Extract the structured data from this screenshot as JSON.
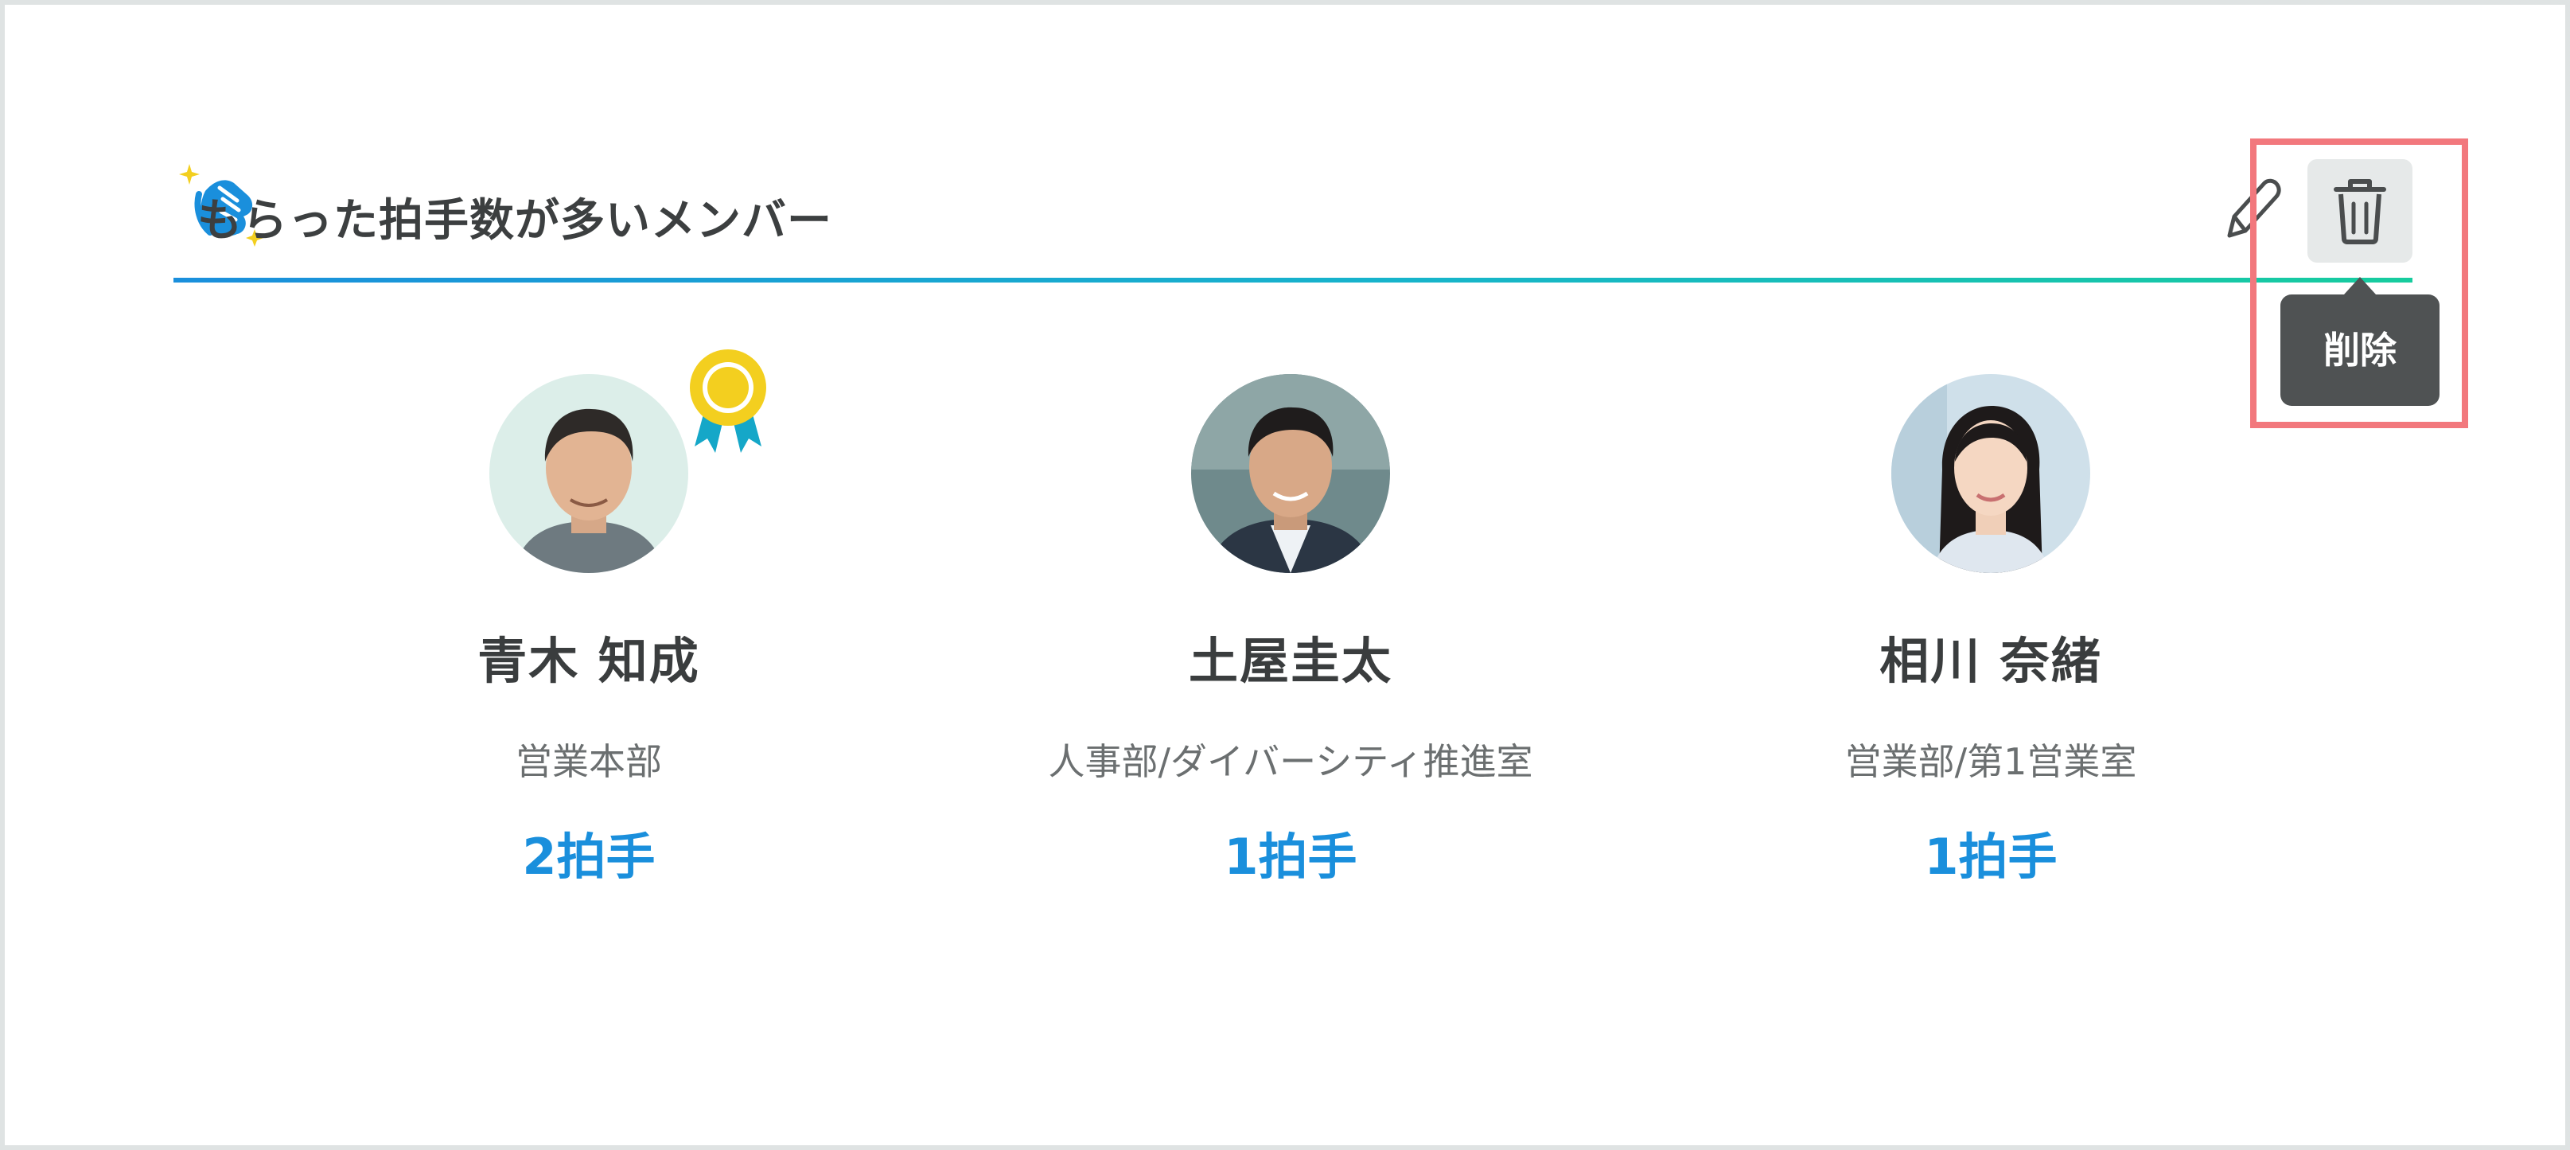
{
  "widget": {
    "title": "もらった拍手数が多いメンバー",
    "edit_icon": "pencil-icon",
    "delete_icon": "trash-icon",
    "delete_tooltip": "削除",
    "title_icon": "clapping-hands-icon",
    "highlight_color": "#f2787d",
    "accent_color": "#1a8fdc"
  },
  "members": [
    {
      "name": "青木 知成",
      "department": "営業本部",
      "claps": "2拍手",
      "badge": "award-medal-icon"
    },
    {
      "name": "土屋圭太",
      "department": "人事部/ダイバーシティ推進室",
      "claps": "1拍手"
    },
    {
      "name": "相川 奈緒",
      "department": "営業部/第1営業室",
      "claps": "1拍手"
    }
  ]
}
